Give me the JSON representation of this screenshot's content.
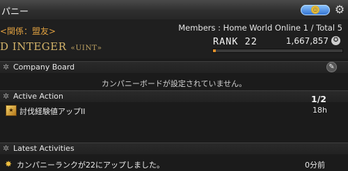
{
  "window": {
    "title": "パニー",
    "pill_icon": "coin-icon",
    "gear_icon": "gear-icon"
  },
  "company": {
    "relation": "<関係：盟友>",
    "name": "D INTEGER",
    "tag": "«UINT»",
    "members_text": "Members : Home World Online 1 / Total 5",
    "rank_label": "RANK 22",
    "points": "1,667,857",
    "rank_progress_fraction": 0.02,
    "accent_color": "#e0902a"
  },
  "company_board": {
    "label": "Company Board",
    "message": "カンパニーボードが設定されていません。"
  },
  "active_action": {
    "label": "Active Action",
    "count": "1/2",
    "items": [
      {
        "name": "討伐経験値アップII",
        "time": "18h"
      }
    ]
  },
  "latest_activities": {
    "label": "Latest Activities",
    "items": [
      {
        "text": "カンパニーランクが22にアップしました。",
        "time": "0分前"
      }
    ]
  }
}
